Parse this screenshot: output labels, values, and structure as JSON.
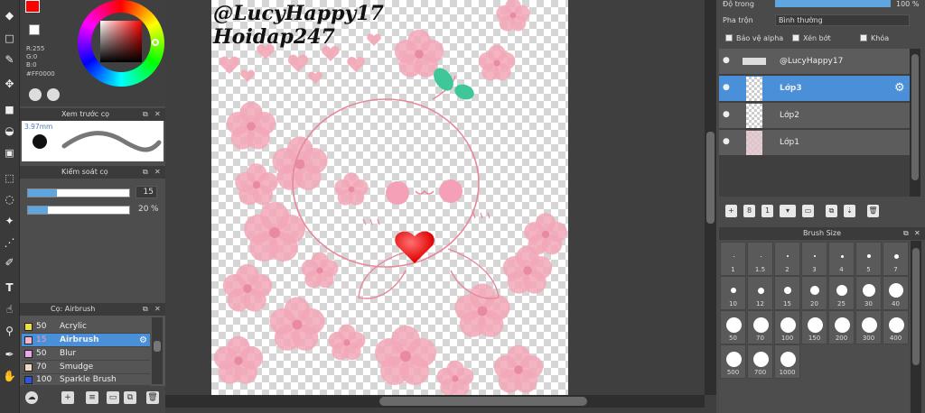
{
  "color": {
    "r": "R:255",
    "g": "G:0",
    "b": "B:0",
    "hex": "#FF0000",
    "main": "#ff0000"
  },
  "panels": {
    "preview_title": "Xem trước cọ",
    "preview_size": "3.97mm",
    "brush_control_title": "Kiểm soát cọ",
    "size_value": "15",
    "opacity_value": "20",
    "opacity_unit": "%",
    "size_fraction": 0.29,
    "opacity_fraction": 0.2,
    "brush_title": "Cọ: Airbrush"
  },
  "brushes": [
    {
      "num": "50",
      "name": "Acrylic",
      "color": "#f0e040"
    },
    {
      "num": "15",
      "name": "Airbrush",
      "color": "#f5b6c6"
    },
    {
      "num": "50",
      "name": "Blur",
      "color": "#e8a9e8"
    },
    {
      "num": "70",
      "name": "Smudge",
      "color": "#f2d8c0"
    },
    {
      "num": "100",
      "name": "Sparkle Brush",
      "color": "#2f55e0"
    }
  ],
  "canvas": {
    "watermark1": "@LucyHappy17",
    "watermark2": "Hoidap247"
  },
  "right": {
    "opacity_label": "Độ trong",
    "opacity_value": "100 %",
    "blend_label": "Pha trộn",
    "blend_value": "Bình thường",
    "protect_alpha": "Bảo vệ alpha",
    "clipping": "Xén bớt",
    "lock": "Khóa"
  },
  "layers": [
    {
      "name": "@LucyHappy17",
      "selected": false
    },
    {
      "name": "Lớp3",
      "selected": true
    },
    {
      "name": "Lớp2",
      "selected": false
    },
    {
      "name": "Lớp1",
      "selected": false
    }
  ],
  "brush_size": {
    "title": "Brush Size",
    "sizes": [
      "1",
      "1.5",
      "2",
      "3",
      "4",
      "5",
      "7",
      "10",
      "12",
      "15",
      "20",
      "25",
      "30",
      "40",
      "50",
      "70",
      "100",
      "150",
      "200",
      "300",
      "400",
      "500",
      "700",
      "1000"
    ]
  }
}
